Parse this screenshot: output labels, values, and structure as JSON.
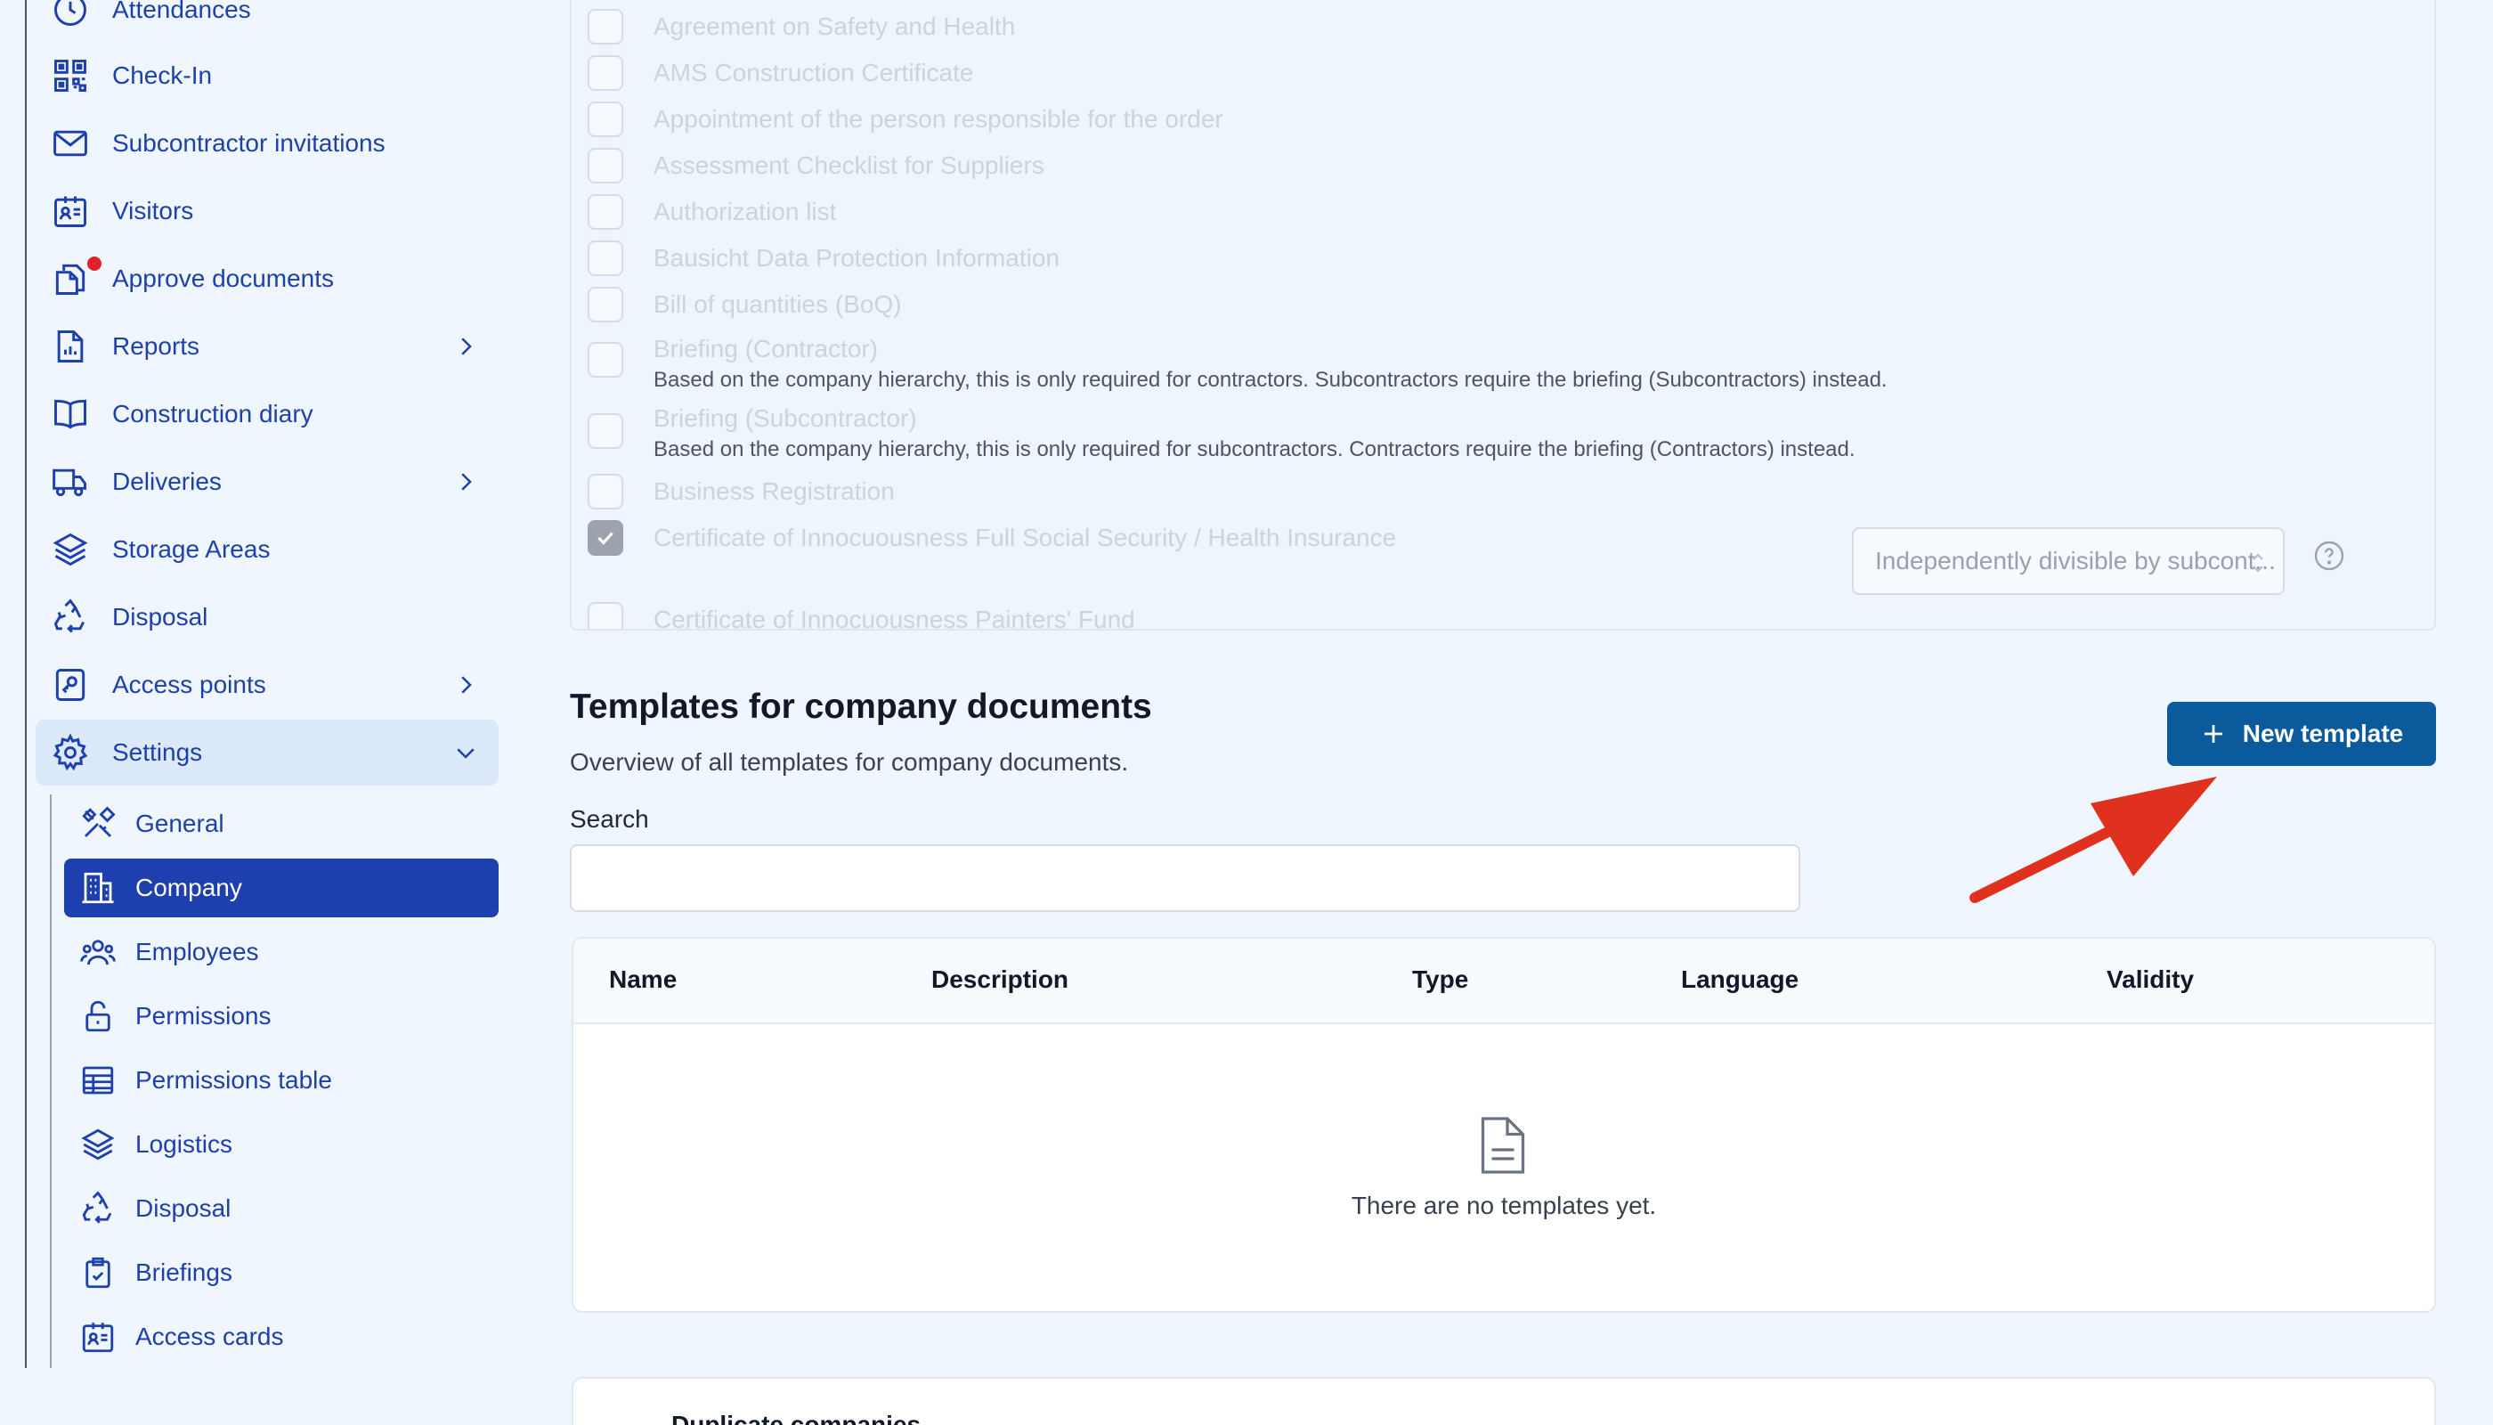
{
  "sidebar": {
    "items": [
      {
        "label": "Attendances",
        "icon": "clock-icon"
      },
      {
        "label": "Check-In",
        "icon": "qr-code-icon"
      },
      {
        "label": "Subcontractor invitations",
        "icon": "envelope-icon"
      },
      {
        "label": "Visitors",
        "icon": "id-card-icon"
      },
      {
        "label": "Approve documents",
        "icon": "documents-icon"
      },
      {
        "label": "Reports",
        "icon": "report-icon"
      },
      {
        "label": "Construction diary",
        "icon": "book-icon"
      },
      {
        "label": "Deliveries",
        "icon": "truck-icon"
      },
      {
        "label": "Storage Areas",
        "icon": "layers-icon"
      },
      {
        "label": "Disposal",
        "icon": "recycle-icon"
      },
      {
        "label": "Access points",
        "icon": "key-card-icon"
      },
      {
        "label": "Settings",
        "icon": "gear-icon"
      }
    ],
    "settings_children": [
      {
        "label": "General",
        "icon": "tools-icon"
      },
      {
        "label": "Company",
        "icon": "building-icon"
      },
      {
        "label": "Employees",
        "icon": "users-icon"
      },
      {
        "label": "Permissions",
        "icon": "lock-open-icon"
      },
      {
        "label": "Permissions table",
        "icon": "table-icon"
      },
      {
        "label": "Logistics",
        "icon": "layers-icon"
      },
      {
        "label": "Disposal",
        "icon": "recycle-icon"
      },
      {
        "label": "Briefings",
        "icon": "clipboard-check-icon"
      },
      {
        "label": "Access cards",
        "icon": "id-card-icon"
      }
    ],
    "active_child": "Company",
    "approve_documents_badge": "red-dot",
    "accent_color": "#1e3fae"
  },
  "documents": {
    "items": [
      {
        "title": "Agreement on Safety and Health",
        "checked": false
      },
      {
        "title": "AMS Construction Certificate",
        "checked": false
      },
      {
        "title": "Appointment of the person responsible for the order",
        "checked": false
      },
      {
        "title": "Assessment Checklist for Suppliers",
        "checked": false
      },
      {
        "title": "Authorization list",
        "checked": false
      },
      {
        "title": "Bausicht Data Protection Information",
        "checked": false
      },
      {
        "title": "Bill of quantities (BoQ)",
        "checked": false
      },
      {
        "title": "Briefing (Contractor)",
        "sub": "Based on the company hierarchy, this is only required for contractors. Subcontractors require the briefing (Subcontractors) instead.",
        "checked": false
      },
      {
        "title": "Briefing (Subcontractor)",
        "sub": "Based on the company hierarchy, this is only required for subcontractors. Contractors require the briefing (Contractors) instead.",
        "checked": false
      },
      {
        "title": "Business Registration",
        "checked": false
      },
      {
        "title": "Certificate of Innocuousness Full Social Security / Health Insurance",
        "checked": true
      },
      {
        "title": "Certificate of Innocuousness Painters' Fund",
        "checked": false
      }
    ],
    "select_value": "Independently divisible by subcont..."
  },
  "templates": {
    "heading": "Templates for company documents",
    "description": "Overview of all templates for company documents.",
    "new_button": "New template",
    "search_label": "Search",
    "search_value": "",
    "columns": [
      "Name",
      "Description",
      "Type",
      "Language",
      "Validity"
    ],
    "empty_text": "There are no templates yet.",
    "button_color": "#0a5a9c"
  },
  "annotation": {
    "arrow_color": "#e0301e"
  },
  "duplicate": {
    "title": "Duplicate companies"
  }
}
